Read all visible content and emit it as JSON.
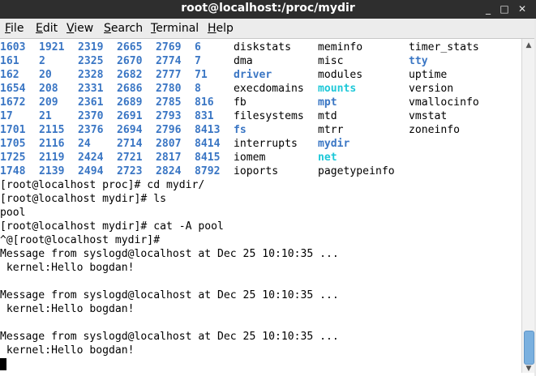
{
  "window": {
    "title": "root@localhost:/proc/mydir"
  },
  "controls": {
    "minimize": "_",
    "maximize": "□",
    "close": "✕"
  },
  "menu": [
    "File",
    "Edit",
    "View",
    "Search",
    "Terminal",
    "Help"
  ],
  "menu_hotkeys": [
    "F",
    "E",
    "V",
    "S",
    "T",
    "H"
  ],
  "listing": {
    "rows": [
      [
        "1603",
        "1921",
        "2319",
        "2665",
        "2769",
        "6",
        "diskstats",
        "meminfo",
        "timer_stats"
      ],
      [
        "161",
        "2",
        "2325",
        "2670",
        "2774",
        "7",
        "dma",
        "misc",
        "tty"
      ],
      [
        "162",
        "20",
        "2328",
        "2682",
        "2777",
        "71",
        "driver",
        "modules",
        "uptime"
      ],
      [
        "1654",
        "208",
        "2331",
        "2686",
        "2780",
        "8",
        "execdomains",
        "mounts",
        "version"
      ],
      [
        "1672",
        "209",
        "2361",
        "2689",
        "2785",
        "816",
        "fb",
        "mpt",
        "vmallocinfo"
      ],
      [
        "17",
        "21",
        "2370",
        "2691",
        "2793",
        "831",
        "filesystems",
        "mtd",
        "vmstat"
      ],
      [
        "1701",
        "2115",
        "2376",
        "2694",
        "2796",
        "8413",
        "fs",
        "mtrr",
        "zoneinfo"
      ],
      [
        "1705",
        "2116",
        "24",
        "2714",
        "2807",
        "8414",
        "interrupts",
        "mydir",
        ""
      ],
      [
        "1725",
        "2119",
        "2424",
        "2721",
        "2817",
        "8415",
        "iomem",
        "net",
        ""
      ],
      [
        "1748",
        "2139",
        "2494",
        "2723",
        "2824",
        "8792",
        "ioports",
        "pagetypeinfo",
        ""
      ]
    ],
    "blue": [
      "tty",
      "driver",
      "fs",
      "mpt",
      "mydir"
    ],
    "cyan": [
      "mounts",
      "net"
    ]
  },
  "output": [
    "[root@localhost proc]# cd mydir/",
    "[root@localhost mydir]# ls",
    "pool",
    "[root@localhost mydir]# cat -A pool",
    "^@[root@localhost mydir]#",
    "Message from syslogd@localhost at Dec 25 10:10:35 ...",
    " kernel:Hello bogdan!",
    "",
    "Message from syslogd@localhost at Dec 25 10:10:35 ...",
    " kernel:Hello bogdan!",
    "",
    "Message from syslogd@localhost at Dec 25 10:10:35 ...",
    " kernel:Hello bogdan!"
  ]
}
